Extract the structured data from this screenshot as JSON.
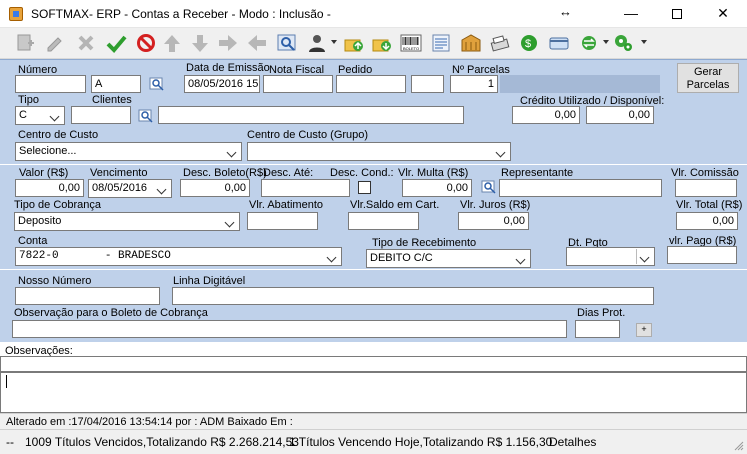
{
  "window": {
    "title": "SOFTMAX- ERP - Contas a Receber  - Modo : Inclusão -",
    "resize_glyph": "↔",
    "minimize": "—",
    "close": "✕"
  },
  "toolbar": {
    "icons": [
      "new-record-icon",
      "edit-icon",
      "delete-icon",
      "confirm-icon",
      "cancel-icon",
      "first-icon",
      "last-icon",
      "next-icon",
      "previous-icon",
      "search-icon",
      "user-icon",
      "upload-icon",
      "download-icon",
      "boleto-icon",
      "report-icon",
      "archive-icon",
      "print-icon",
      "money-icon",
      "card-icon",
      "exchange-icon",
      "settings-icon"
    ],
    "boleto_label": "BOLETO"
  },
  "form": {
    "numero": {
      "label": "Número",
      "value": ""
    },
    "serie": {
      "value": "A"
    },
    "data_emissao": {
      "label": "Data de Emissão",
      "value": "08/05/2016 15"
    },
    "nota_fiscal": {
      "label": "Nota Fiscal",
      "value": ""
    },
    "pedido": {
      "label": "Pedido",
      "value": ""
    },
    "parcelas": {
      "label": "Nº Parcelas",
      "value": "1"
    },
    "gerar_parcelas": "Gerar\nParcelas",
    "tipo": {
      "label": "Tipo",
      "value": "C"
    },
    "clientes": {
      "label": "Clientes",
      "code": "",
      "name": ""
    },
    "credito": {
      "label": "Crédito Utilizado / Disponível:",
      "utilizado": "0,00",
      "disponivel": "0,00"
    },
    "centro_custo": {
      "label": "Centro de Custo",
      "value": "Selecione..."
    },
    "centro_custo_grupo": {
      "label": "Centro de Custo (Grupo)",
      "value": ""
    },
    "valor": {
      "label": "Valor (R$)",
      "value": "0,00"
    },
    "vencimento": {
      "label": "Vencimento",
      "value": "08/05/2016"
    },
    "desc_boleto": {
      "label": "Desc. Boleto(R$)",
      "value": "0,00"
    },
    "desc_ate": {
      "label": "Desc. Até:",
      "value": ""
    },
    "desc_cond": {
      "label": "Desc. Cond.:"
    },
    "vlr_multa": {
      "label": "Vlr. Multa (R$)",
      "value": "0,00"
    },
    "representante": {
      "label": "Representante",
      "value": ""
    },
    "vlr_comissao": {
      "label": "Vlr. Comissão",
      "value": ""
    },
    "tipo_cobranca": {
      "label": "Tipo de Cobrança",
      "value": "Deposito"
    },
    "vlr_abatimento": {
      "label": "Vlr. Abatimento",
      "value": ""
    },
    "vlr_saldo": {
      "label": "Vlr.Saldo em Cart.",
      "value": ""
    },
    "vlr_juros": {
      "label": "Vlr. Juros (R$)",
      "value": "0,00"
    },
    "vlr_total": {
      "label": "Vlr. Total (R$)",
      "value": "0,00"
    },
    "conta": {
      "label": "Conta",
      "value": "7822-0       - BRADESCO"
    },
    "tipo_recebimento": {
      "label": "Tipo de Recebimento",
      "value": "DEBITO C/C"
    },
    "dt_pgto": {
      "label": "Dt. Pgto",
      "value": ""
    },
    "vlr_pago": {
      "label": "vlr. Pago (R$)",
      "value": ""
    },
    "nosso_numero": {
      "label": "Nosso Número",
      "value": ""
    },
    "linha_digitavel": {
      "label": "Linha Digitável",
      "value": ""
    },
    "obs_boleto": {
      "label": "Observação para o Boleto de Cobrança",
      "value": ""
    },
    "dias_prot": {
      "label": "Dias Prot.",
      "value": ""
    },
    "small_button": "+"
  },
  "observacoes": {
    "label": "Observações:"
  },
  "status": {
    "alterado": "Alterado  em :17/04/2016 13:54:14  por : ADM  Baixado Em :",
    "dashes": "--",
    "vencidos": "1009 Títulos Vencidos,Totalizando R$ 2.268.214,53",
    "vencendo": "1 Títulos Vencendo Hoje,Totalizando R$ 1.156,30",
    "detalhes": "Detalhes"
  },
  "colors": {
    "panel": "#bfd1ea",
    "accent": "#3b7be8"
  }
}
